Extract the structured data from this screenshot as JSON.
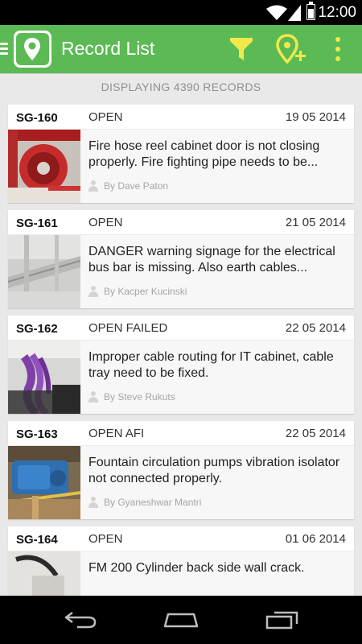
{
  "status_bar": {
    "time": "12:00"
  },
  "app_bar": {
    "title": "Record List"
  },
  "banner": {
    "text": "DISPLAYING 4390 RECORDS"
  },
  "colors": {
    "primary": "#5cba55",
    "accent": "#f1e84a"
  },
  "records": [
    {
      "code": "SG-160",
      "status": "OPEN",
      "date": "19 05 2014",
      "description": "Fire hose reel cabinet door is not closing properly. Fire fighting pipe needs to be...",
      "author": "By Dave Paton"
    },
    {
      "code": "SG-161",
      "status": "OPEN",
      "date": "21 05 2014",
      "description": "DANGER warning signage for the electrical bus bar is missing. Also earth cables...",
      "author": "By Kacper Kucinski"
    },
    {
      "code": "SG-162",
      "status": "OPEN FAILED",
      "date": "22 05 2014",
      "description": "Improper cable routing for IT cabinet, cable tray need to be fixed.",
      "author": "By Steve Rukuts"
    },
    {
      "code": "SG-163",
      "status": "OPEN AFI",
      "date": "22 05 2014",
      "description": "Fountain circulation pumps vibration isolator not connected properly.",
      "author": "By Gyaneshwar Mantri"
    },
    {
      "code": "SG-164",
      "status": "OPEN",
      "date": "01 06 2014",
      "description": "FM 200 Cylinder back side wall crack.",
      "author": ""
    }
  ]
}
